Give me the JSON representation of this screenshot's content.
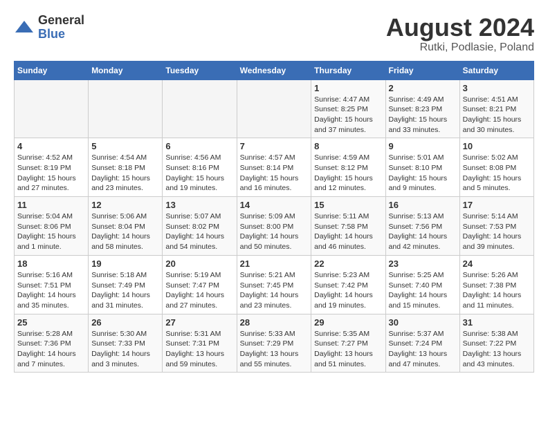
{
  "logo": {
    "general": "General",
    "blue": "Blue"
  },
  "title": "August 2024",
  "subtitle": "Rutki, Podlasie, Poland",
  "weekdays": [
    "Sunday",
    "Monday",
    "Tuesday",
    "Wednesday",
    "Thursday",
    "Friday",
    "Saturday"
  ],
  "weeks": [
    [
      {
        "day": "",
        "info": ""
      },
      {
        "day": "",
        "info": ""
      },
      {
        "day": "",
        "info": ""
      },
      {
        "day": "",
        "info": ""
      },
      {
        "day": "1",
        "info": "Sunrise: 4:47 AM\nSunset: 8:25 PM\nDaylight: 15 hours\nand 37 minutes."
      },
      {
        "day": "2",
        "info": "Sunrise: 4:49 AM\nSunset: 8:23 PM\nDaylight: 15 hours\nand 33 minutes."
      },
      {
        "day": "3",
        "info": "Sunrise: 4:51 AM\nSunset: 8:21 PM\nDaylight: 15 hours\nand 30 minutes."
      }
    ],
    [
      {
        "day": "4",
        "info": "Sunrise: 4:52 AM\nSunset: 8:19 PM\nDaylight: 15 hours\nand 27 minutes."
      },
      {
        "day": "5",
        "info": "Sunrise: 4:54 AM\nSunset: 8:18 PM\nDaylight: 15 hours\nand 23 minutes."
      },
      {
        "day": "6",
        "info": "Sunrise: 4:56 AM\nSunset: 8:16 PM\nDaylight: 15 hours\nand 19 minutes."
      },
      {
        "day": "7",
        "info": "Sunrise: 4:57 AM\nSunset: 8:14 PM\nDaylight: 15 hours\nand 16 minutes."
      },
      {
        "day": "8",
        "info": "Sunrise: 4:59 AM\nSunset: 8:12 PM\nDaylight: 15 hours\nand 12 minutes."
      },
      {
        "day": "9",
        "info": "Sunrise: 5:01 AM\nSunset: 8:10 PM\nDaylight: 15 hours\nand 9 minutes."
      },
      {
        "day": "10",
        "info": "Sunrise: 5:02 AM\nSunset: 8:08 PM\nDaylight: 15 hours\nand 5 minutes."
      }
    ],
    [
      {
        "day": "11",
        "info": "Sunrise: 5:04 AM\nSunset: 8:06 PM\nDaylight: 15 hours\nand 1 minute."
      },
      {
        "day": "12",
        "info": "Sunrise: 5:06 AM\nSunset: 8:04 PM\nDaylight: 14 hours\nand 58 minutes."
      },
      {
        "day": "13",
        "info": "Sunrise: 5:07 AM\nSunset: 8:02 PM\nDaylight: 14 hours\nand 54 minutes."
      },
      {
        "day": "14",
        "info": "Sunrise: 5:09 AM\nSunset: 8:00 PM\nDaylight: 14 hours\nand 50 minutes."
      },
      {
        "day": "15",
        "info": "Sunrise: 5:11 AM\nSunset: 7:58 PM\nDaylight: 14 hours\nand 46 minutes."
      },
      {
        "day": "16",
        "info": "Sunrise: 5:13 AM\nSunset: 7:56 PM\nDaylight: 14 hours\nand 42 minutes."
      },
      {
        "day": "17",
        "info": "Sunrise: 5:14 AM\nSunset: 7:53 PM\nDaylight: 14 hours\nand 39 minutes."
      }
    ],
    [
      {
        "day": "18",
        "info": "Sunrise: 5:16 AM\nSunset: 7:51 PM\nDaylight: 14 hours\nand 35 minutes."
      },
      {
        "day": "19",
        "info": "Sunrise: 5:18 AM\nSunset: 7:49 PM\nDaylight: 14 hours\nand 31 minutes."
      },
      {
        "day": "20",
        "info": "Sunrise: 5:19 AM\nSunset: 7:47 PM\nDaylight: 14 hours\nand 27 minutes."
      },
      {
        "day": "21",
        "info": "Sunrise: 5:21 AM\nSunset: 7:45 PM\nDaylight: 14 hours\nand 23 minutes."
      },
      {
        "day": "22",
        "info": "Sunrise: 5:23 AM\nSunset: 7:42 PM\nDaylight: 14 hours\nand 19 minutes."
      },
      {
        "day": "23",
        "info": "Sunrise: 5:25 AM\nSunset: 7:40 PM\nDaylight: 14 hours\nand 15 minutes."
      },
      {
        "day": "24",
        "info": "Sunrise: 5:26 AM\nSunset: 7:38 PM\nDaylight: 14 hours\nand 11 minutes."
      }
    ],
    [
      {
        "day": "25",
        "info": "Sunrise: 5:28 AM\nSunset: 7:36 PM\nDaylight: 14 hours\nand 7 minutes."
      },
      {
        "day": "26",
        "info": "Sunrise: 5:30 AM\nSunset: 7:33 PM\nDaylight: 14 hours\nand 3 minutes."
      },
      {
        "day": "27",
        "info": "Sunrise: 5:31 AM\nSunset: 7:31 PM\nDaylight: 13 hours\nand 59 minutes."
      },
      {
        "day": "28",
        "info": "Sunrise: 5:33 AM\nSunset: 7:29 PM\nDaylight: 13 hours\nand 55 minutes."
      },
      {
        "day": "29",
        "info": "Sunrise: 5:35 AM\nSunset: 7:27 PM\nDaylight: 13 hours\nand 51 minutes."
      },
      {
        "day": "30",
        "info": "Sunrise: 5:37 AM\nSunset: 7:24 PM\nDaylight: 13 hours\nand 47 minutes."
      },
      {
        "day": "31",
        "info": "Sunrise: 5:38 AM\nSunset: 7:22 PM\nDaylight: 13 hours\nand 43 minutes."
      }
    ]
  ]
}
